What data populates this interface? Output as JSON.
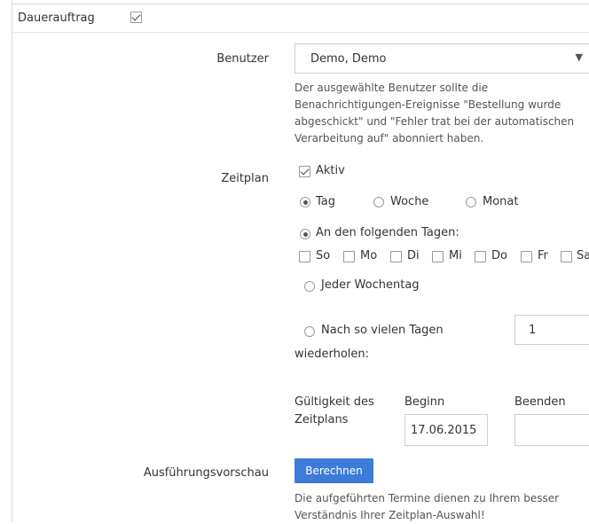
{
  "dauerauftrag": {
    "label": "Dauerauftrag",
    "checked": true
  },
  "benutzer": {
    "label": "Benutzer",
    "value": "Demo, Demo",
    "help": [
      "Der ausgewählte Benutzer sollte die",
      "Benachrichtigungen-Ereignisse \"Bestellung wurde",
      "abgeschickt\" und \"Fehler trat bei der automatischen",
      "Verarbeitung auf\" abonniert haben."
    ]
  },
  "zeitplan": {
    "label": "Zeitplan",
    "aktiv": {
      "label": "Aktiv",
      "checked": true
    },
    "frequency": {
      "options": [
        "Tag",
        "Woche",
        "Monat"
      ],
      "selected": "Tag"
    },
    "on_days": {
      "label": "An den folgenden Tagen:",
      "selected": true
    },
    "days": [
      "So",
      "Mo",
      "Di",
      "Mi",
      "Do",
      "Fr",
      "Sa"
    ],
    "every_weekday": {
      "label": "Jeder Wochentag",
      "selected": false
    },
    "repeat_after": {
      "label_line1": "Nach so vielen Tagen",
      "label_line2": "wiederholen:",
      "selected": false,
      "value": "1"
    }
  },
  "gueltigkeit": {
    "label_line1": "Gültigkeit des",
    "label_line2": "Zeitplans",
    "beginn_label": "Beginn",
    "beginn_value": "17.06.2015",
    "beenden_label": "Beenden",
    "beenden_value": ""
  },
  "vorschau": {
    "label": "Ausführungsvorschau",
    "button": "Berechnen",
    "help": [
      "Die aufgeführten Termine dienen zu Ihrem besser",
      "Verständnis Ihrer Zeitplan-Auswahl!"
    ]
  }
}
